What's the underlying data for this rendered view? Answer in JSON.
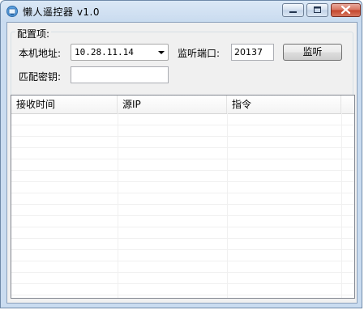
{
  "window": {
    "title": "懒人遥控器 v1.0"
  },
  "config": {
    "group_title": "配置项:",
    "local_address_label": "本机地址:",
    "local_address_value": "10.28.11.14",
    "listen_port_label": "监听端口:",
    "listen_port_value": "20137",
    "listen_button": "监听",
    "pairing_key_label": "匹配密钥:",
    "pairing_key_value": ""
  },
  "table": {
    "columns": [
      "接收时间",
      "源IP",
      "指令"
    ],
    "rows": []
  },
  "icons": {
    "app": "app-icon",
    "minimize": "minimize-icon",
    "maximize": "maximize-icon",
    "close": "close-icon",
    "dropdown": "chevron-down-icon"
  }
}
